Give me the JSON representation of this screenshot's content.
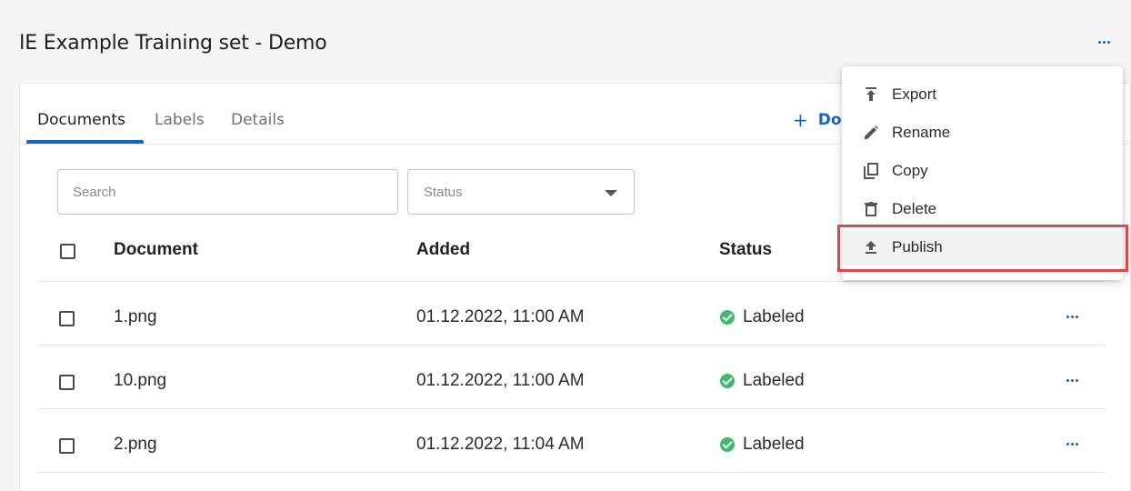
{
  "page": {
    "title": "IE Example Training set - Demo"
  },
  "tabs": [
    {
      "label": "Documents",
      "active": true
    },
    {
      "label": "Labels",
      "active": false
    },
    {
      "label": "Details",
      "active": false
    }
  ],
  "toolbar": {
    "add_document_label": "Doc"
  },
  "filters": {
    "search_placeholder": "Search",
    "status_placeholder": "Status"
  },
  "table": {
    "headers": {
      "document": "Document",
      "added": "Added",
      "status": "Status"
    },
    "rows": [
      {
        "document": "1.png",
        "added": "01.12.2022, 11:00 AM",
        "status": "Labeled"
      },
      {
        "document": "10.png",
        "added": "01.12.2022, 11:00 AM",
        "status": "Labeled"
      },
      {
        "document": "2.png",
        "added": "01.12.2022, 11:04 AM",
        "status": "Labeled"
      }
    ]
  },
  "menu": {
    "items": [
      {
        "label": "Export",
        "icon": "export-icon"
      },
      {
        "label": "Rename",
        "icon": "pencil-icon"
      },
      {
        "label": "Copy",
        "icon": "copy-icon"
      },
      {
        "label": "Delete",
        "icon": "trash-icon"
      },
      {
        "label": "Publish",
        "icon": "publish-icon",
        "highlighted": true
      }
    ]
  },
  "colors": {
    "accent": "#1565c0",
    "success": "#3dbb6a",
    "highlight_border": "#e04848"
  }
}
